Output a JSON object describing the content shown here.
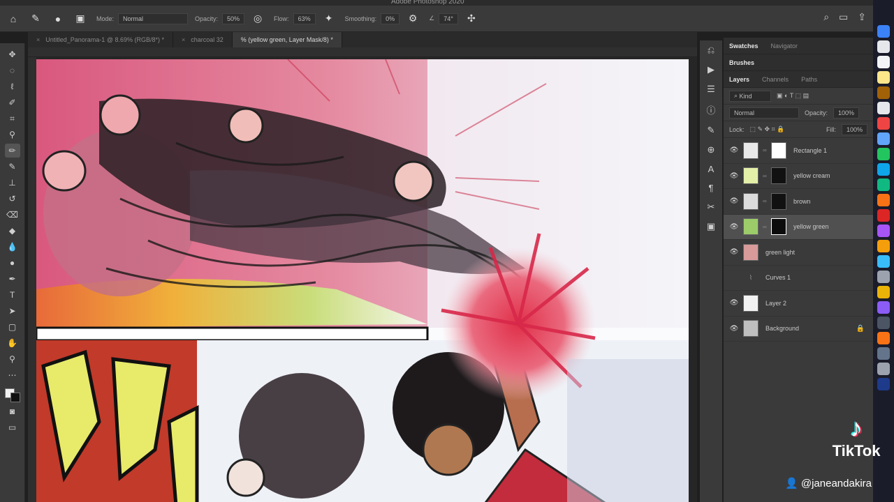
{
  "window": {
    "title": "Adobe Photoshop 2020"
  },
  "options_bar": {
    "mode_label": "Mode:",
    "mode_value": "Normal",
    "opacity_label": "Opacity:",
    "opacity_value": "50%",
    "flow_label": "Flow:",
    "flow_value": "63%",
    "smoothing_label": "Smoothing:",
    "smoothing_value": "0%",
    "angle_value": "74°"
  },
  "doc_tabs": [
    {
      "label": "Untitled_Panorama-1 @ 8.69% (RGB/8*) *"
    },
    {
      "label": "charcoal 32"
    },
    {
      "label": "% (yellow green, Layer Mask/8) *"
    }
  ],
  "panels": {
    "top_tabs": [
      "Swatches",
      "Navigator"
    ],
    "brushes_tab": "Brushes",
    "layer_tabs": [
      "Layers",
      "Channels",
      "Paths"
    ],
    "filter_label": "Kind",
    "blend_mode": "Normal",
    "opacity_label": "Opacity:",
    "opacity_value": "100%",
    "lock_label": "Lock:",
    "fill_label": "Fill:",
    "fill_value": "100%",
    "layers": [
      {
        "name": "Rectangle 1",
        "thumb": "#e9e9e9",
        "mask": "#ffffff"
      },
      {
        "name": "yellow cream",
        "thumb": "#e4f0a8",
        "mask": "#111111"
      },
      {
        "name": "brown",
        "thumb": "#dcdcdc",
        "mask": "#111111"
      },
      {
        "name": "yellow green",
        "thumb": "#9ccc6a",
        "mask": "#0c0c0c"
      },
      {
        "name": "green light",
        "thumb": "#d99a9a",
        "mask": ""
      },
      {
        "name": "Curves 1",
        "thumb": "",
        "mask": ""
      },
      {
        "name": "Layer 2",
        "thumb": "#f2f2f2",
        "mask": ""
      },
      {
        "name": "Background",
        "thumb": "#bfbfbf",
        "mask": ""
      }
    ]
  },
  "watermark": {
    "brand": "TikTok",
    "handle": "@janeandakira"
  }
}
